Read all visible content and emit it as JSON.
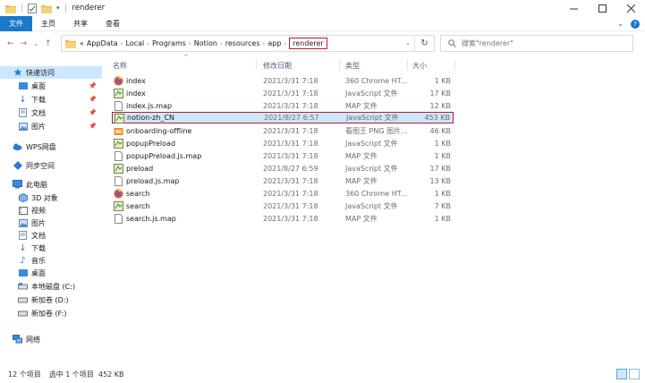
{
  "window": {
    "title": "renderer"
  },
  "ribbon": {
    "tabs": [
      "文件",
      "主页",
      "共享",
      "查看"
    ]
  },
  "address": {
    "overflow": "«",
    "crumbs": [
      "AppData",
      "Local",
      "Programs",
      "Notion",
      "resources",
      "app",
      "renderer"
    ]
  },
  "search": {
    "placeholder": "搜索\"renderer\""
  },
  "sidebar": {
    "quick_access": "快速访问",
    "quick_items": [
      "桌面",
      "下载",
      "文档",
      "图片"
    ],
    "wps": "WPS网盘",
    "sync": "同步空间",
    "this_pc": "此电脑",
    "pc_items": [
      "3D 对象",
      "视频",
      "图片",
      "文档",
      "下载",
      "音乐",
      "桌面",
      "本地磁盘 (C:)",
      "新加卷 (D:)",
      "新加卷 (F:)"
    ],
    "network": "网络"
  },
  "columns": {
    "name": "名称",
    "date": "修改日期",
    "type": "类型",
    "size": "大小"
  },
  "files": [
    {
      "name": "index",
      "date": "2021/3/31 7:18",
      "type": "360 Chrome HT...",
      "size": "1 KB",
      "icon": "html-icon"
    },
    {
      "name": "index",
      "date": "2021/3/31 7:18",
      "type": "JavaScript 文件",
      "size": "17 KB",
      "icon": "js-icon"
    },
    {
      "name": "index.js.map",
      "date": "2021/3/31 7:18",
      "type": "MAP 文件",
      "size": "12 KB",
      "icon": "map-file-icon"
    },
    {
      "name": "notion-zh_CN",
      "date": "2021/8/27 6:57",
      "type": "JavaScript 文件",
      "size": "453 KB",
      "icon": "js-icon"
    },
    {
      "name": "onboarding-offline",
      "date": "2021/3/31 7:18",
      "type": "看图王 PNG 图片...",
      "size": "46 KB",
      "icon": "png-icon"
    },
    {
      "name": "popupPreload",
      "date": "2021/3/31 7:18",
      "type": "JavaScript 文件",
      "size": "1 KB",
      "icon": "js-icon"
    },
    {
      "name": "popupPreload.js.map",
      "date": "2021/3/31 7:18",
      "type": "MAP 文件",
      "size": "1 KB",
      "icon": "map-file-icon"
    },
    {
      "name": "preload",
      "date": "2021/8/27 6:59",
      "type": "JavaScript 文件",
      "size": "17 KB",
      "icon": "js-icon"
    },
    {
      "name": "preload.js.map",
      "date": "2021/3/31 7:18",
      "type": "MAP 文件",
      "size": "13 KB",
      "icon": "map-file-icon"
    },
    {
      "name": "search",
      "date": "2021/3/31 7:18",
      "type": "360 Chrome HT...",
      "size": "1 KB",
      "icon": "html-icon"
    },
    {
      "name": "search",
      "date": "2021/3/31 7:18",
      "type": "JavaScript 文件",
      "size": "7 KB",
      "icon": "js-icon"
    },
    {
      "name": "search.js.map",
      "date": "2021/3/31 7:18",
      "type": "MAP 文件",
      "size": "1 KB",
      "icon": "map-file-icon"
    }
  ],
  "status": {
    "count": "12 个项目",
    "selected": "选中 1 个项目  452 KB"
  },
  "colors": {
    "accent": "#1979ca",
    "selection": "#cce8ff",
    "highlight_border": "#c01a2a"
  }
}
